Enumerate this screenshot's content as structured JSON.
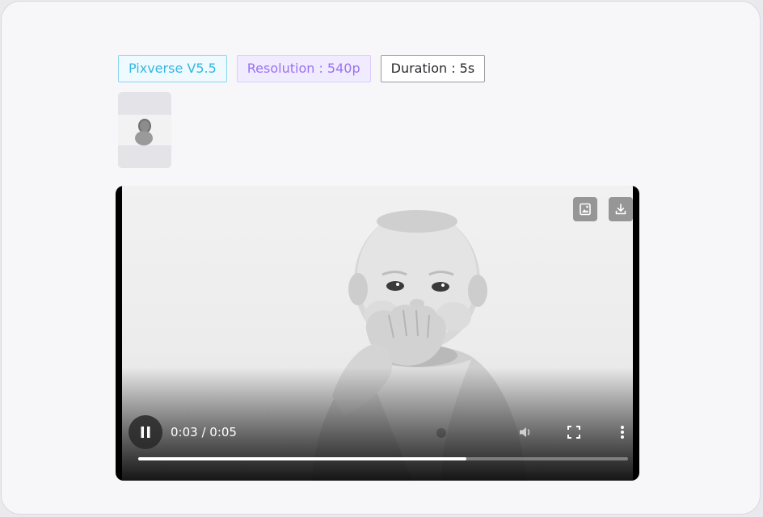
{
  "tags": {
    "model": "Pixverse V5.5",
    "resolution": "Resolution : 540p",
    "duration": "Duration : 5s"
  },
  "player": {
    "time": "0:03 / 0:05",
    "progress": 0.67,
    "state": "playing"
  },
  "icons": {
    "frame": "image-frame-icon",
    "download": "download-icon",
    "pause": "pause-icon",
    "volume": "volume-icon",
    "fullscreen": "fullscreen-icon",
    "more": "more-vertical-icon"
  },
  "colors": {
    "model_tag": "#38b6e0",
    "resolution_tag": "#9a72f2",
    "duration_tag": "#2a2a2e"
  }
}
